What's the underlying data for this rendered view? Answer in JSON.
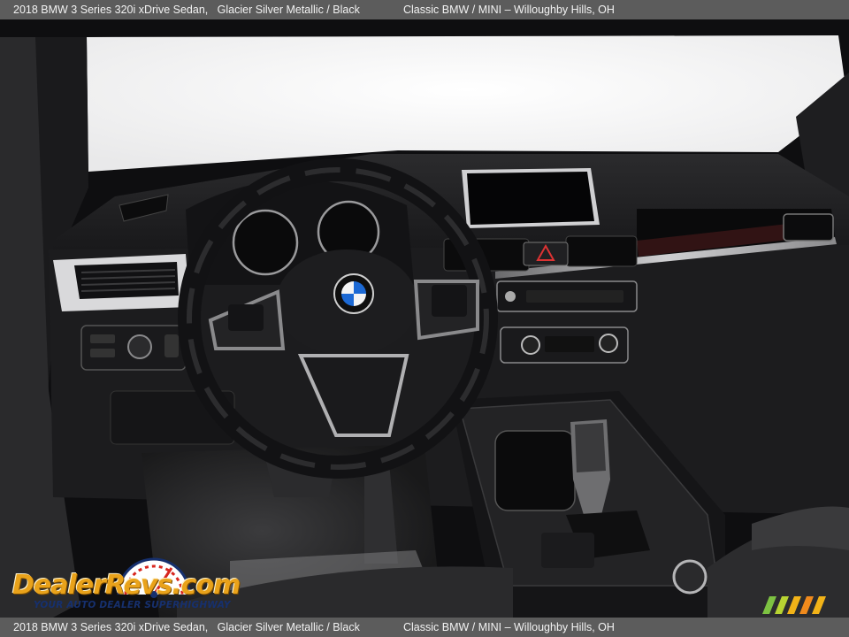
{
  "header": {
    "vehicle_title": "2018 BMW 3 Series 320i xDrive Sedan,",
    "colors": "Glacier Silver Metallic / Black",
    "dealer": "Classic BMW / MINI – Willoughby Hills, OH"
  },
  "footer": {
    "vehicle_title": "2018 BMW 3 Series 320i xDrive Sedan,",
    "colors": "Glacier Silver Metallic / Black",
    "dealer": "Classic BMW / MINI – Willoughby Hills, OH"
  },
  "watermark": {
    "brand": "DealerRevs.com",
    "tagline": "YOUR AUTO DEALER SUPERHIGHWAY"
  },
  "theme": {
    "bar_color": "#5c5c5c",
    "bar_text": "#f2f2f2",
    "brand_orange": "#e9a21a",
    "brand_blue": "#16306e"
  }
}
